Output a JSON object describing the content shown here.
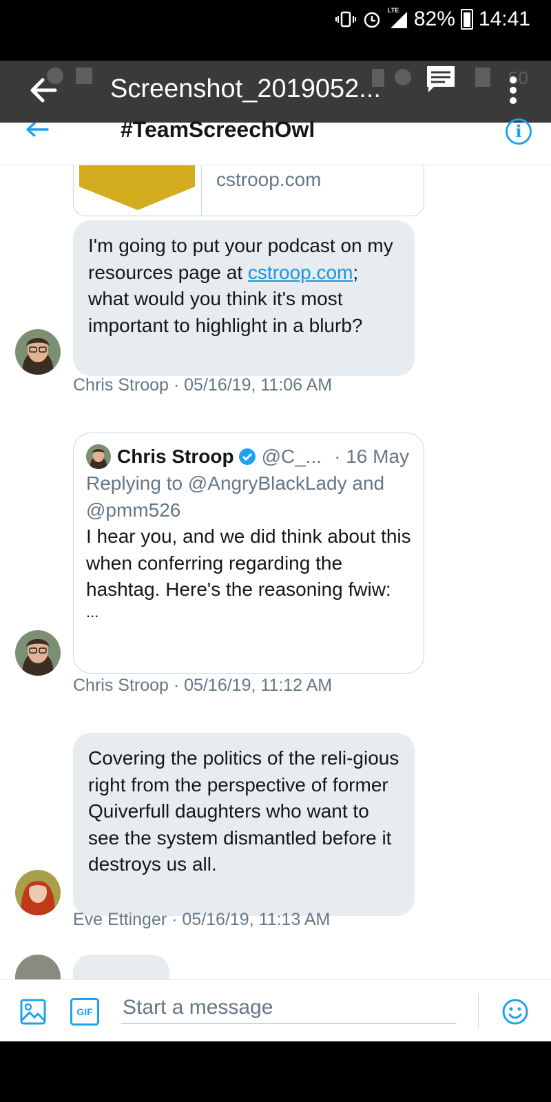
{
  "status_bar": {
    "network": "LTE",
    "battery": "82%",
    "time": "14:41"
  },
  "viewer": {
    "title": "Screenshot_2019052..."
  },
  "header": {
    "title": "#TeamScreechOwl"
  },
  "conversation": {
    "link_card": {
      "domain": "cstroop.com"
    },
    "messages": [
      {
        "text_before": "I'm going to put your podcast on my resources page at ",
        "link": "cstroop.com",
        "text_after": "; what would you think it's most important to highlight in a blurb?",
        "meta": "Chris Stroop · 05/16/19, 11:06 AM"
      },
      {
        "quote": {
          "name": "Chris Stroop",
          "handle": "@C_...",
          "date": "· 16 May",
          "replying": "Replying to @AngryBlackLady and @pmm526",
          "text": "I hear you, and we did think about this when conferring regarding the hashtag. Here's the reasoning fwiw:",
          "ellipsis": "..."
        },
        "meta": "Chris Stroop · 05/16/19, 11:12 AM"
      },
      {
        "text": "Covering the politics of the reli-gious right from the perspective of former Quiverfull daughters who want to see the system dismantled before it destroys us all.",
        "meta": "Eve Ettinger · 05/16/19, 11:13 AM"
      }
    ]
  },
  "composer": {
    "placeholder": "Start a message",
    "gif_label": "GIF"
  },
  "colors": {
    "accent": "#1da1f2",
    "bubble": "#e6ecf0",
    "muted": "#657786",
    "text": "#14171a"
  },
  "icons": [
    "back-arrow-icon",
    "comment-icon",
    "more-icon",
    "info-icon",
    "verified-icon",
    "image-icon",
    "gif-icon",
    "emoji-icon"
  ]
}
